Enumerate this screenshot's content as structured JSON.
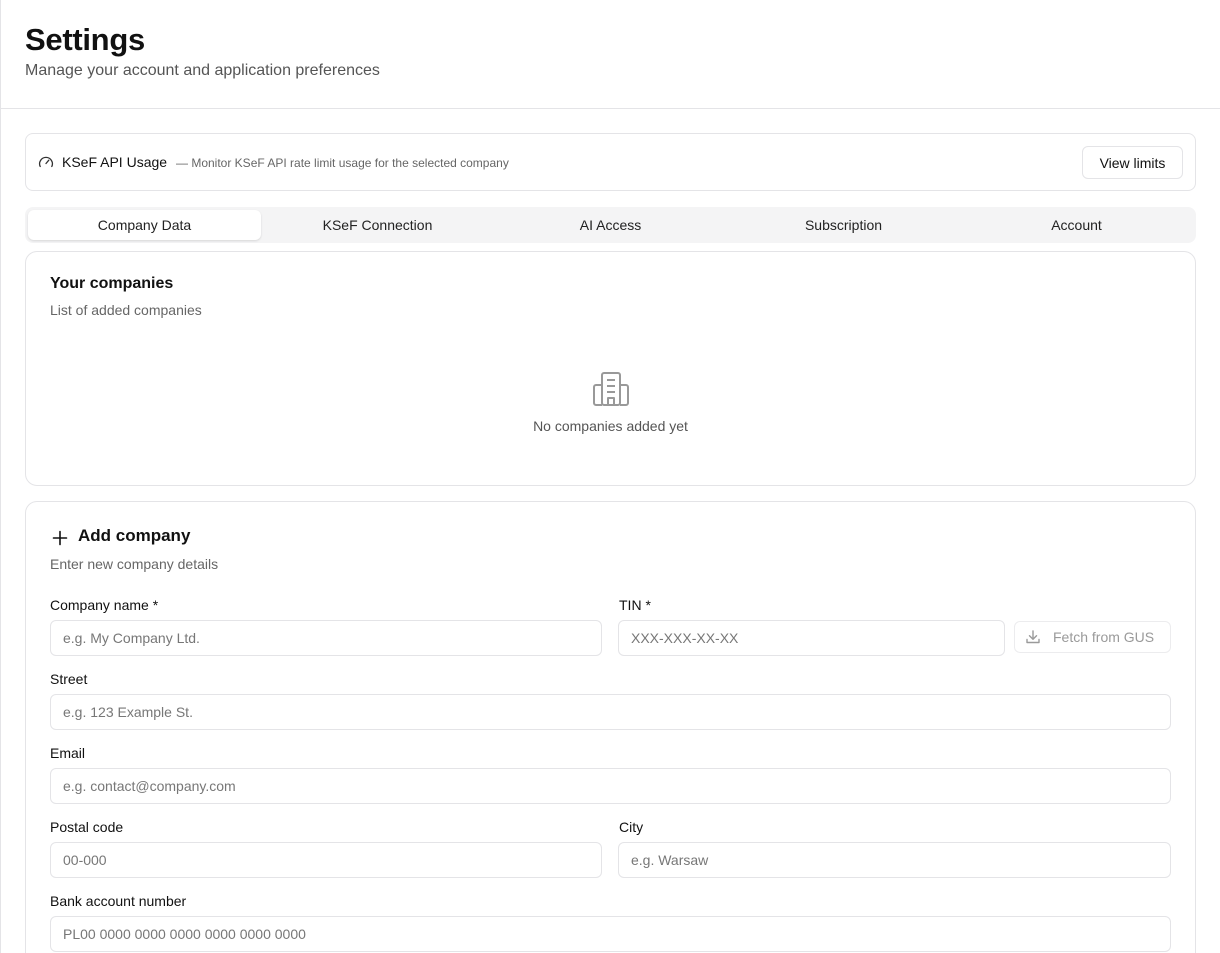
{
  "header": {
    "title": "Settings",
    "subtitle": "Manage your account and application preferences"
  },
  "usage": {
    "icon": "gauge-icon",
    "title": "KSeF API Usage",
    "description": "— Monitor KSeF API rate limit usage for the selected company",
    "button_label": "View limits"
  },
  "tabs": [
    {
      "label": "Company Data",
      "active": true
    },
    {
      "label": "KSeF Connection",
      "active": false
    },
    {
      "label": "AI Access",
      "active": false
    },
    {
      "label": "Subscription",
      "active": false
    },
    {
      "label": "Account",
      "active": false
    }
  ],
  "companies": {
    "title": "Your companies",
    "subtitle": "List of added companies",
    "empty_icon": "building-icon",
    "empty_text": "No companies added yet"
  },
  "add_company": {
    "icon": "plus-icon",
    "title": "Add company",
    "subtitle": "Enter new company details",
    "fields": {
      "company_name": {
        "label": "Company name *",
        "placeholder": "e.g. My Company Ltd.",
        "value": ""
      },
      "tin": {
        "label": "TIN *",
        "placeholder": "XXX-XXX-XX-XX",
        "value": ""
      },
      "street": {
        "label": "Street",
        "placeholder": "e.g. 123 Example St.",
        "value": ""
      },
      "email": {
        "label": "Email",
        "placeholder": "e.g. contact@company.com",
        "value": ""
      },
      "postal_code": {
        "label": "Postal code",
        "placeholder": "00-000",
        "value": ""
      },
      "city": {
        "label": "City",
        "placeholder": "e.g. Warsaw",
        "value": ""
      },
      "bank_account": {
        "label": "Bank account number",
        "placeholder": "PL00 0000 0000 0000 0000 0000 0000",
        "value": ""
      }
    },
    "fetch_gus": {
      "icon": "download-icon",
      "label": "Fetch from GUS"
    }
  }
}
